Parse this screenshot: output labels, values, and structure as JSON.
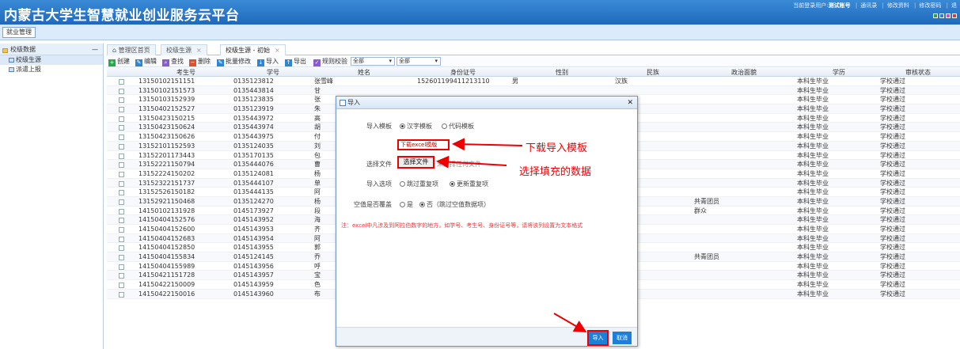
{
  "header": {
    "title": "内蒙古大学生智慧就业创业服务云平台",
    "user_prefix": "当前登录用户:",
    "user_name": "测试账号",
    "links": [
      "通讯录",
      "修改资料",
      "修改密码",
      "退"
    ],
    "skin_colors": [
      "#3b9a3b",
      "#2f7fd0",
      "#d04fb8",
      "#d43a3a"
    ]
  },
  "nav": {
    "main": "就业管理"
  },
  "sidebar": {
    "header": "校级数据",
    "collapse": "—",
    "items": [
      {
        "label": "校级生源"
      },
      {
        "label": "派遣上报"
      }
    ]
  },
  "tabs": [
    {
      "label": "管理区首页"
    },
    {
      "label": "校级生源"
    },
    {
      "label": "校级生源 - 初始"
    }
  ],
  "toolbar": {
    "items": [
      {
        "label": "创建",
        "color": "#29a84a"
      },
      {
        "label": "编辑",
        "color": "#2d86d2"
      },
      {
        "label": "查找",
        "color": "#8a5cd1"
      },
      {
        "label": "删除",
        "color": "#e0502b"
      },
      {
        "label": "批量修改",
        "color": "#2d86d2"
      },
      {
        "label": "导入",
        "color": "#2d86d2"
      },
      {
        "label": "导出",
        "color": "#2d86d2"
      },
      {
        "label": "规则校验",
        "color": "#8a5cd1"
      }
    ],
    "select1": "全部",
    "select2": "全部"
  },
  "grid": {
    "headers": [
      "考生号",
      "学号",
      "姓名",
      "身份证号",
      "性别",
      "民族",
      "政治面貌",
      "学历",
      "审核状态"
    ],
    "rows": [
      [
        "13150102151151",
        "0135123812",
        "张雪峰",
        "152601199411213110",
        "男",
        "汉族",
        "",
        "本科生毕业",
        "学校通过"
      ],
      [
        "13150102151573",
        "0135443814",
        "甘",
        "",
        "",
        "",
        "",
        "本科生毕业",
        "学校通过"
      ],
      [
        "13150103152939",
        "0135123835",
        "张",
        "",
        "",
        "",
        "",
        "本科生毕业",
        "学校通过"
      ],
      [
        "13150402152527",
        "0135123919",
        "朱",
        "",
        "",
        "",
        "",
        "本科生毕业",
        "学校通过"
      ],
      [
        "13150423150215",
        "0135443972",
        "高",
        "",
        "",
        "",
        "",
        "本科生毕业",
        "学校通过"
      ],
      [
        "13150423150624",
        "0135443974",
        "胡",
        "",
        "",
        "",
        "",
        "本科生毕业",
        "学校通过"
      ],
      [
        "13150423150626",
        "0135443975",
        "付",
        "",
        "",
        "",
        "",
        "本科生毕业",
        "学校通过"
      ],
      [
        "13152101152593",
        "0135124035",
        "刘",
        "",
        "",
        "",
        "",
        "本科生毕业",
        "学校通过"
      ],
      [
        "13152201173443",
        "0135170135",
        "包",
        "",
        "",
        "",
        "",
        "本科生毕业",
        "学校通过"
      ],
      [
        "13152221150794",
        "0135444076",
        "曹",
        "",
        "",
        "",
        "",
        "本科生毕业",
        "学校通过"
      ],
      [
        "13152224150202",
        "0135124081",
        "杨",
        "",
        "",
        "",
        "",
        "本科生毕业",
        "学校通过"
      ],
      [
        "13152322151737",
        "0135444107",
        "单",
        "",
        "",
        "",
        "",
        "本科生毕业",
        "学校通过"
      ],
      [
        "13152526150182",
        "0135444135",
        "阿",
        "",
        "",
        "",
        "",
        "本科生毕业",
        "学校通过"
      ],
      [
        "13152921150468",
        "0135124270",
        "杨",
        "",
        "",
        "",
        "共青团员",
        "本科生毕业",
        "学校通过"
      ],
      [
        "14150102131928",
        "0145173927",
        "段",
        "",
        "",
        "",
        "群众",
        "本科生毕业",
        "学校通过"
      ],
      [
        "14150404152576",
        "0145143952",
        "海",
        "",
        "",
        "",
        "",
        "本科生毕业",
        "学校通过"
      ],
      [
        "14150404152600",
        "0145143953",
        "齐",
        "",
        "",
        "",
        "",
        "本科生毕业",
        "学校通过"
      ],
      [
        "14150404152683",
        "0145143954",
        "阿",
        "",
        "",
        "",
        "",
        "本科生毕业",
        "学校通过"
      ],
      [
        "14150404152850",
        "0145143955",
        "郭",
        "",
        "",
        "",
        "",
        "本科生毕业",
        "学校通过"
      ],
      [
        "14150404155834",
        "0145124145",
        "乔",
        "",
        "",
        "",
        "共青团员",
        "本科生毕业",
        "学校通过"
      ],
      [
        "14150404155989",
        "0145143956",
        "呼",
        "",
        "",
        "",
        "",
        "本科生毕业",
        "学校通过"
      ],
      [
        "14150421151728",
        "0145143957",
        "宝",
        "",
        "",
        "",
        "",
        "本科生毕业",
        "学校通过"
      ],
      [
        "14150422150009",
        "0145143959",
        "色",
        "",
        "",
        "",
        "",
        "本科生毕业",
        "学校通过"
      ],
      [
        "14150422150016",
        "0145143960",
        "布",
        "",
        "",
        "",
        "",
        "本科生毕业",
        "学校通过"
      ]
    ]
  },
  "dialog": {
    "title": "导入",
    "close": "✕",
    "template_label": "导入模板",
    "template_opts": [
      "汉字模板",
      "代码模板"
    ],
    "download_link": "下载excel模版",
    "file_label": "选择文件",
    "choose_button": "选择文件",
    "file_hint": "未选择任何文件",
    "import_label": "导入选项",
    "import_opts": [
      "跳过重复项",
      "更新重复项"
    ],
    "overwrite_label": "空值是否覆盖",
    "overwrite_opts": [
      "是",
      "否（跳过空值数据项）"
    ],
    "note": "注：excel中凡涉及到阿拉伯数字的地方，如学号、考生号、身份证号等，请将该列设置为文本格式",
    "import_button": "导入",
    "cancel_button": "取消"
  },
  "annotations": {
    "download": "下载导入模板",
    "fill": "选择填充的数据"
  }
}
